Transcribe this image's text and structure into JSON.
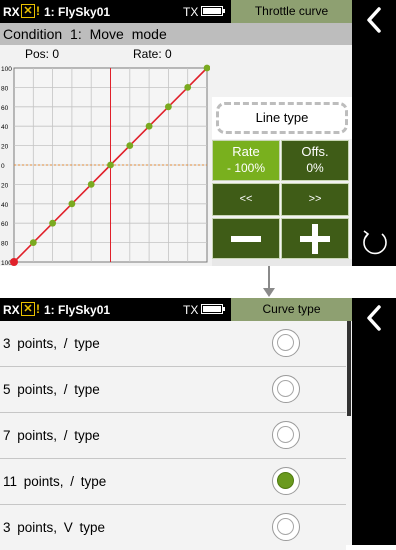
{
  "colors": {
    "title_bg": "#8ea071",
    "button_dark": "#3f5c17",
    "button_light": "#79b01e",
    "curve": "#e0202a",
    "point": "#7aaa20"
  },
  "screen1": {
    "status": {
      "rx": "RX",
      "rx_warning_icon": "x-box-icon",
      "alarm": "!",
      "model": "1: FlySky01",
      "tx": "TX"
    },
    "title": "Throttle curve",
    "condition": "Condition 1:  Move mode",
    "pos_label": "Pos: 0",
    "rate_label": "Rate: 0",
    "line_type_label": "Line type",
    "rate_title": "Rate",
    "rate_value": "- 100%",
    "offs_title": "Offs.",
    "offs_value": "0%",
    "prev_label": "<<",
    "next_label": ">>",
    "minus_icon": "minus-icon",
    "plus_icon": "plus-icon",
    "back_icon": "back-chevron-icon",
    "rotate_icon": "rotate-icon",
    "chart_data": {
      "type": "line",
      "title": "",
      "xlabel": "",
      "ylabel": "",
      "ylim": [
        -100,
        100
      ],
      "y_ticks": [
        "100",
        "80",
        "60",
        "40",
        "20",
        "0",
        "20",
        "40",
        "60",
        "80",
        "100"
      ],
      "grid": true,
      "x": [
        -100,
        -80,
        -60,
        -40,
        -20,
        0,
        20,
        40,
        60,
        80,
        100
      ],
      "y": [
        -100,
        -80,
        -60,
        -40,
        -20,
        0,
        20,
        40,
        60,
        80,
        100
      ]
    }
  },
  "screen2": {
    "status": {
      "rx": "RX",
      "rx_warning_icon": "x-box-icon",
      "alarm": "!",
      "model": "1: FlySky01",
      "tx": "TX"
    },
    "title": "Curve type",
    "back_icon": "back-chevron-icon",
    "items": [
      {
        "label": "3 points,  /  type",
        "selected": false
      },
      {
        "label": "5 points,  /  type",
        "selected": false
      },
      {
        "label": "7 points,  /  type",
        "selected": false
      },
      {
        "label": "11 points,  /  type",
        "selected": true
      },
      {
        "label": "3 points,  V  type",
        "selected": false
      }
    ]
  }
}
